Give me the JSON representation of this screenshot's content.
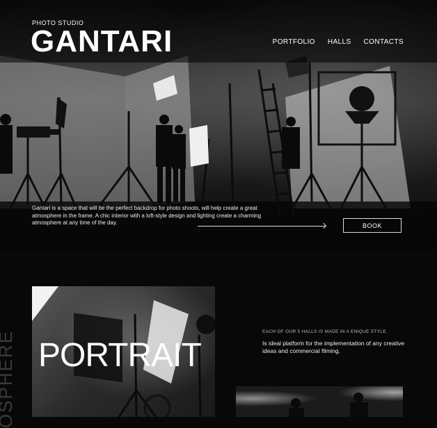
{
  "header": {
    "tagline": "PHOTO STUDIO",
    "brand": "GANTARI",
    "nav": [
      "PORTFOLIO",
      "HALLS",
      "CONTACTS"
    ]
  },
  "hero": {
    "intro": "Gantari is a space that will be the perfect backdrop for photo shoots, will help create a great atmosphere in the frame. A chic interior with a loft-style design and lighting create a charming atmosphere at any time of the day.",
    "book_label": "BOOK"
  },
  "section": {
    "side_text": "OSPHERE",
    "portrait_title": "PORTRAIT",
    "halls_note": "EACH OF OUR 5 HALLS IS MADE IN A ENIQUE STYLE.",
    "halls_desc": "Is ideal platform for the implementation of any creative ideas and commercial filming."
  }
}
